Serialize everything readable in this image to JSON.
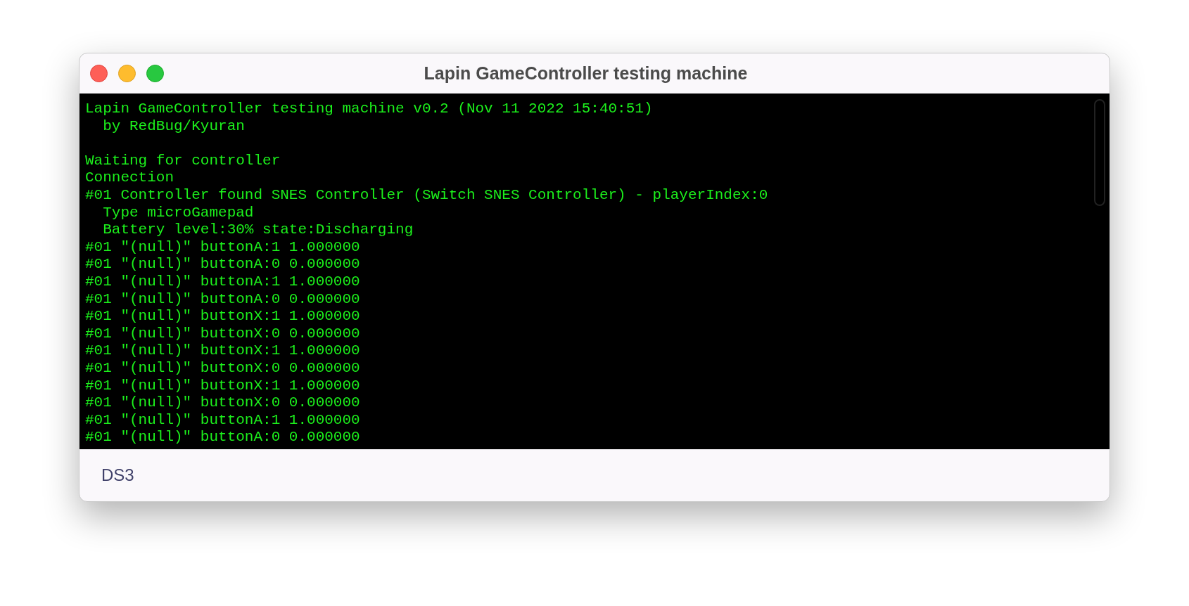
{
  "window": {
    "title": "Lapin GameController testing machine"
  },
  "console": {
    "header": [
      "Lapin GameController testing machine v0.2 (Nov 11 2022 15:40:51)",
      "  by RedBug/Kyuran"
    ],
    "lines": [
      "Waiting for controller",
      "Connection",
      "#01 Controller found SNES Controller (Switch SNES Controller) - playerIndex:0",
      "  Type microGamepad",
      "  Battery level:30% state:Discharging",
      "#01 \"(null)\" buttonA:1 1.000000",
      "#01 \"(null)\" buttonA:0 0.000000",
      "#01 \"(null)\" buttonA:1 1.000000",
      "#01 \"(null)\" buttonA:0 0.000000",
      "#01 \"(null)\" buttonX:1 1.000000",
      "#01 \"(null)\" buttonX:0 0.000000",
      "#01 \"(null)\" buttonX:1 1.000000",
      "#01 \"(null)\" buttonX:0 0.000000",
      "#01 \"(null)\" buttonX:1 1.000000",
      "#01 \"(null)\" buttonX:0 0.000000",
      "#01 \"(null)\" buttonA:1 1.000000",
      "#01 \"(null)\" buttonA:0 0.000000"
    ]
  },
  "footer": {
    "label": "DS3"
  }
}
